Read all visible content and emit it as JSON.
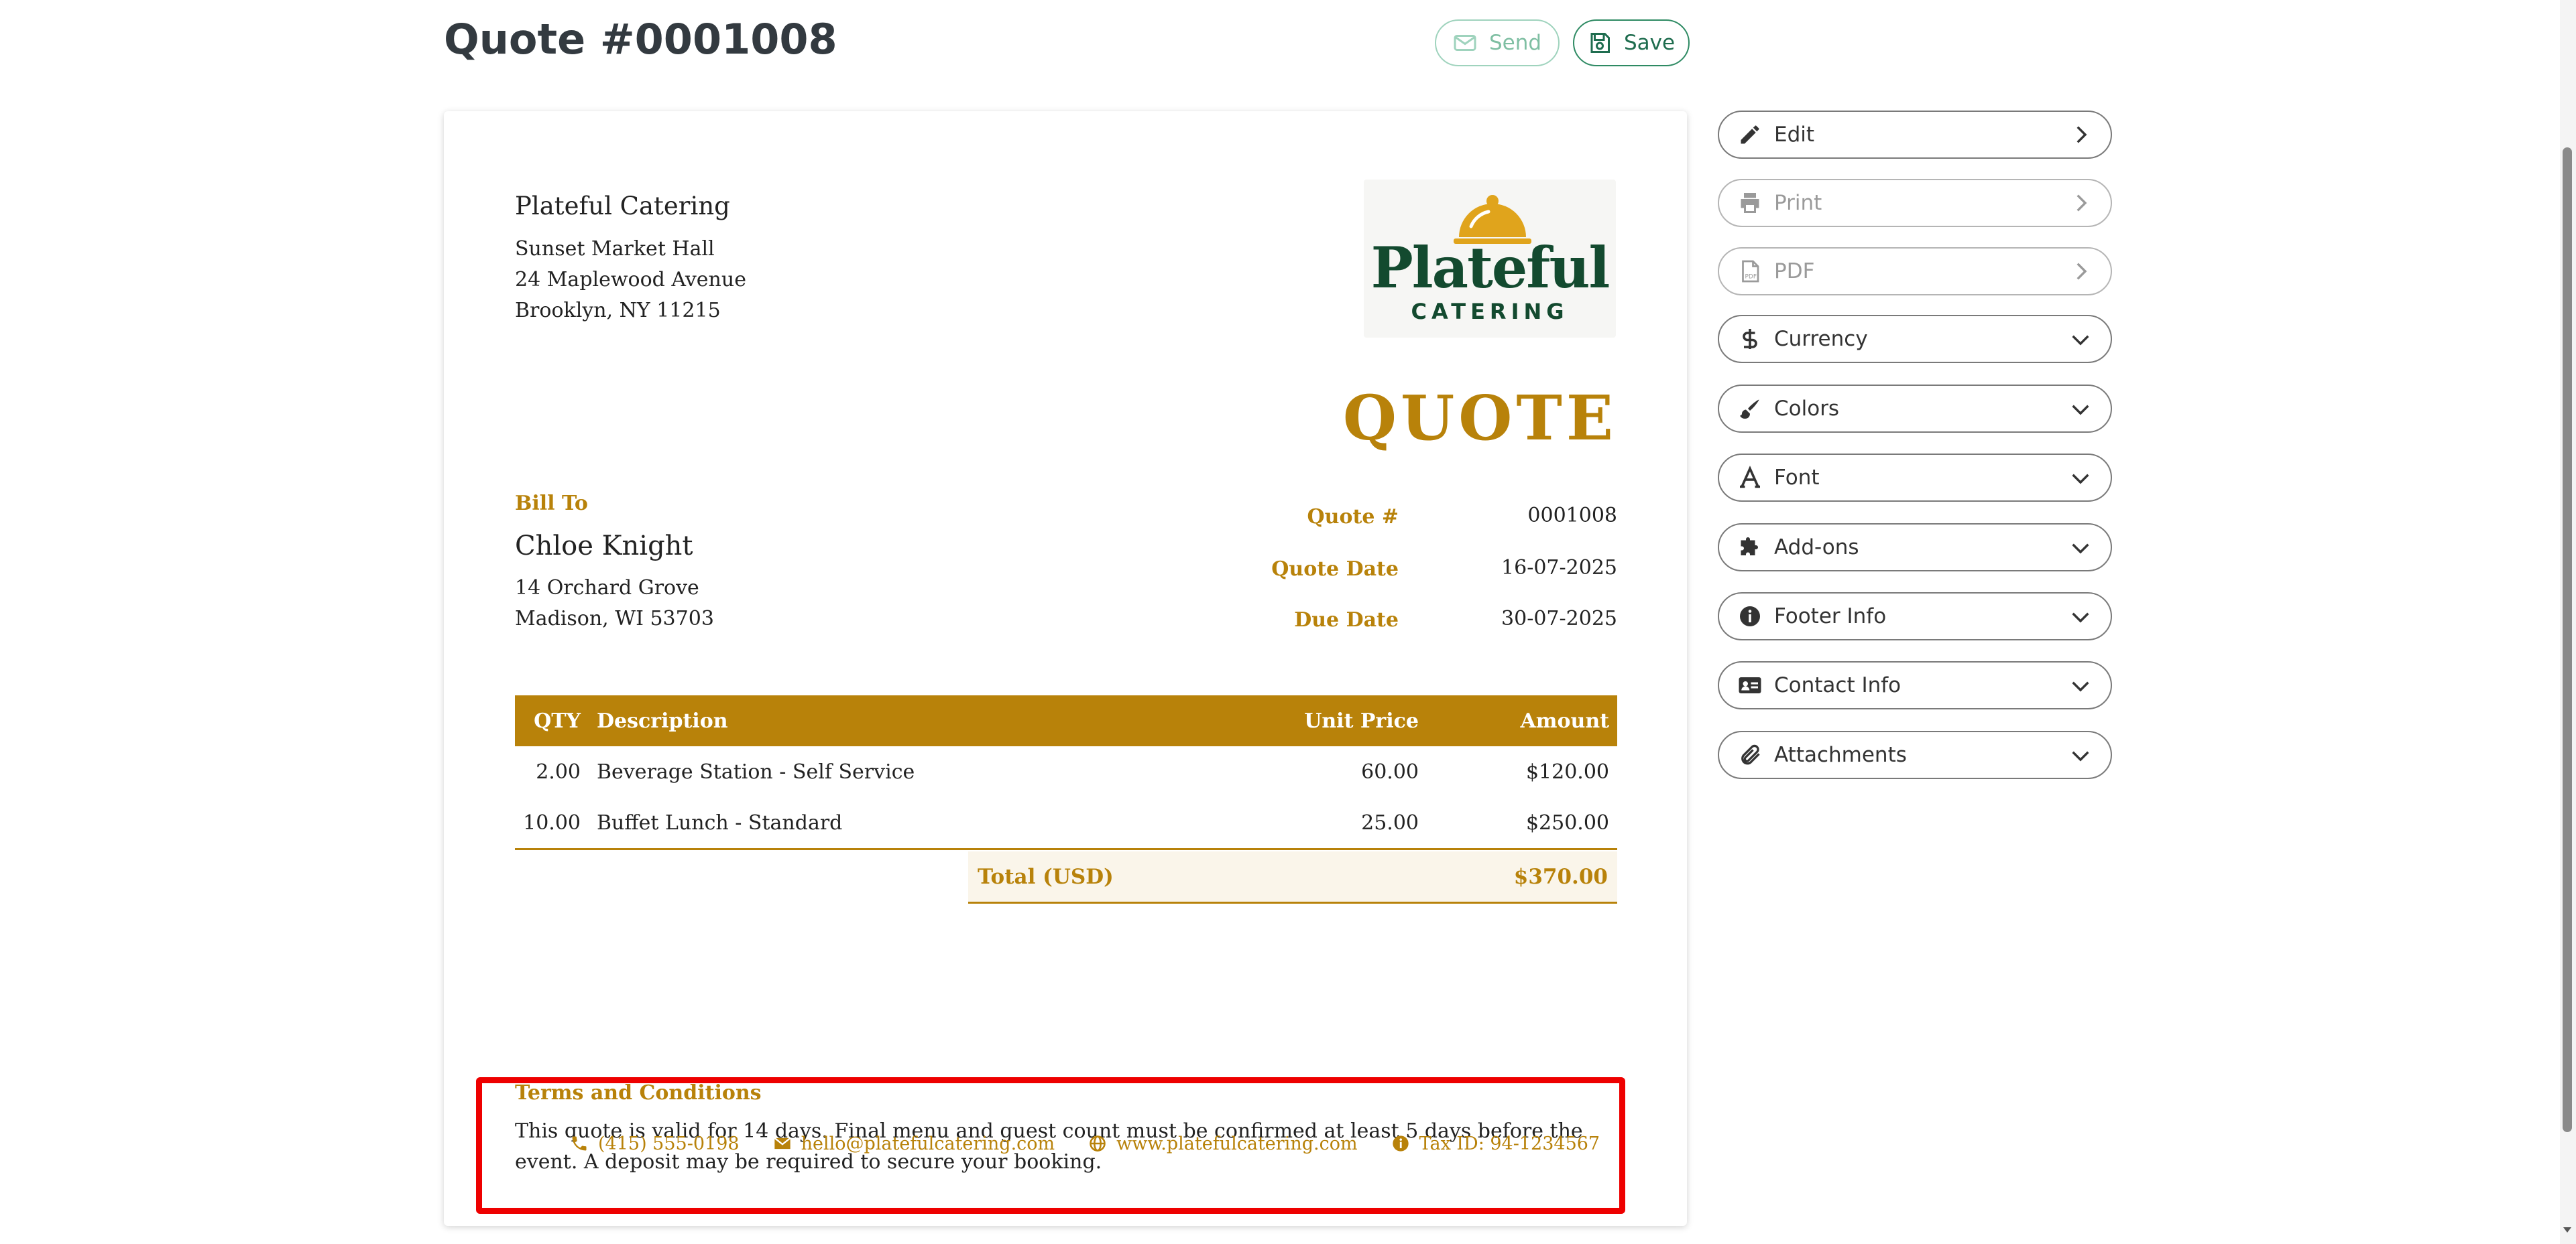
{
  "header": {
    "title": "Quote #0001008",
    "send_label": "Send",
    "save_label": "Save"
  },
  "document": {
    "company": {
      "name": "Plateful Catering",
      "address_lines": [
        "Sunset Market Hall",
        "24 Maplewood Avenue",
        "Brooklyn, NY 11215"
      ]
    },
    "logo": {
      "word": "Plateful",
      "sub": "CATERING"
    },
    "doc_type": "QUOTE",
    "bill_to": {
      "label": "Bill To",
      "name": "Chloe Knight",
      "address_lines": [
        "14 Orchard Grove",
        "Madison, WI 53703"
      ]
    },
    "meta": {
      "quote_num_label": "Quote #",
      "quote_num": "0001008",
      "quote_date_label": "Quote Date",
      "quote_date": "16-07-2025",
      "due_date_label": "Due Date",
      "due_date": "30-07-2025"
    },
    "table": {
      "headers": {
        "qty": "QTY",
        "description": "Description",
        "unit_price": "Unit Price",
        "amount": "Amount"
      },
      "rows": [
        {
          "qty": "2.00",
          "description": "Beverage Station - Self Service",
          "unit_price": "60.00",
          "amount": "$120.00"
        },
        {
          "qty": "10.00",
          "description": "Buffet Lunch - Standard",
          "unit_price": "25.00",
          "amount": "$250.00"
        }
      ],
      "total_label": "Total (USD)",
      "total_value": "$370.00"
    },
    "terms": {
      "title": "Terms and Conditions",
      "text": "This quote is valid for 14 days. Final menu and guest count must be confirmed at least 5 days before the event. A deposit may be required to secure your booking."
    },
    "footer": {
      "phone": "(415) 555-0198",
      "email": "hello@platefulcatering.com",
      "website": "www.platefulcatering.com",
      "tax_id": "Tax ID: 94-1234567"
    }
  },
  "sidebar": {
    "items": [
      {
        "label": "Edit",
        "icon": "pencil-icon",
        "chevron": "right",
        "disabled": false
      },
      {
        "label": "Print",
        "icon": "printer-icon",
        "chevron": "right",
        "disabled": true
      },
      {
        "label": "PDF",
        "icon": "pdf-file-icon",
        "chevron": "right",
        "disabled": true
      },
      {
        "label": "Currency",
        "icon": "dollar-icon",
        "chevron": "down",
        "disabled": false
      },
      {
        "label": "Colors",
        "icon": "paintbrush-icon",
        "chevron": "down",
        "disabled": false
      },
      {
        "label": "Font",
        "icon": "font-icon",
        "chevron": "down",
        "disabled": false
      },
      {
        "label": "Add-ons",
        "icon": "puzzle-icon",
        "chevron": "down",
        "disabled": false
      },
      {
        "label": "Footer Info",
        "icon": "info-icon",
        "chevron": "down",
        "disabled": false
      },
      {
        "label": "Contact Info",
        "icon": "contact-card-icon",
        "chevron": "down",
        "disabled": false
      },
      {
        "label": "Attachments",
        "icon": "paperclip-icon",
        "chevron": "down",
        "disabled": false
      }
    ]
  },
  "colors": {
    "accent_gold": "#b8820a",
    "brand_green": "#134a2f",
    "button_green": "#2e8a63",
    "highlight_red": "#ee0000"
  }
}
